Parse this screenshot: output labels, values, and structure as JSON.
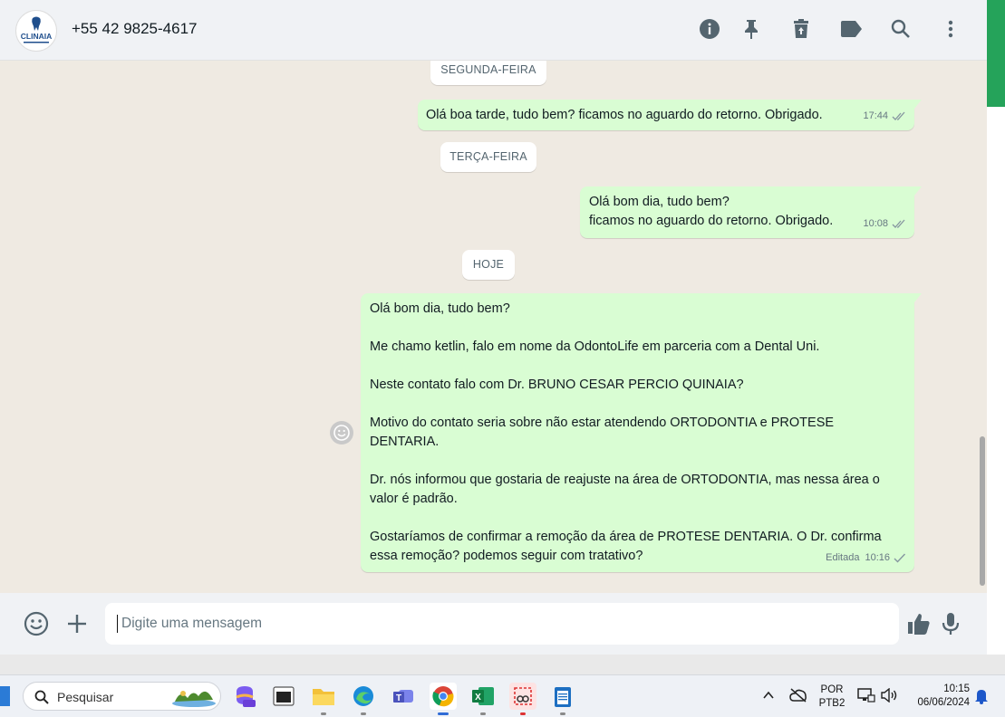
{
  "header": {
    "contact_name": "+55 42 9825-4617",
    "avatar_text": "CLINAIA",
    "icons": [
      "info-icon",
      "pin-icon",
      "delete-icon",
      "label-icon",
      "search-icon",
      "menu-icon"
    ]
  },
  "dates": {
    "monday": "SEGUNDA-FEIRA",
    "tuesday": "TERÇA-FEIRA",
    "today": "HOJE"
  },
  "messages": [
    {
      "text": "Olá boa tarde, tudo bem? ficamos no aguardo do retorno. Obrigado.",
      "time": "17:44",
      "status": "read"
    },
    {
      "text": "Olá bom dia, tudo bem?\nficamos no aguardo do retorno. Obrigado.",
      "time": "10:08",
      "status": "read"
    },
    {
      "text": "Olá bom dia, tudo bem?\n\nMe chamo ketlin, falo em nome da OdontoLife em parceria com a Dental Uni.\n\nNeste contato falo com Dr. BRUNO CESAR PERCIO QUINAIA?\n\nMotivo do contato seria sobre não estar atendendo ORTODONTIA e PROTESE DENTARIA.\n\nDr. nós informou que gostaria de reajuste na área de ORTODONTIA, mas nessa área o valor é padrão.\n\nGostaríamos de confirmar a remoção da área de PROTESE DENTARIA. O Dr. confirma essa remoção? podemos seguir com tratativo?",
      "edited": "Editada",
      "time": "10:16",
      "status": "sent"
    }
  ],
  "composer": {
    "placeholder": "Digite uma mensagem",
    "value": ""
  },
  "taskbar": {
    "search_label": "Pesquisar",
    "language_top": "POR",
    "language_bottom": "PTB2",
    "time": "10:15",
    "date": "06/06/2024"
  },
  "colors": {
    "bubble_out": "#d9fdd3",
    "chat_bg": "#efeae2",
    "header_bg": "#f0f2f5",
    "accent_green": "#25a35a"
  }
}
